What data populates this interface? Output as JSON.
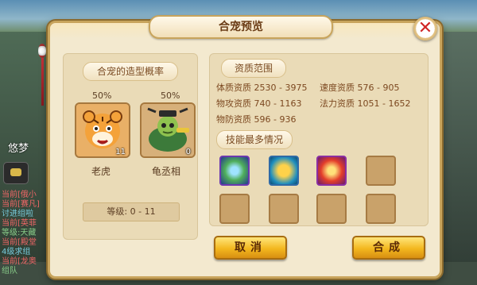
{
  "background": {
    "player_name": "悠梦",
    "chat_lines": [
      {
        "text": "当前[俄小",
        "style": ""
      },
      {
        "text": "当前[赛凡]",
        "style": ""
      },
      {
        "text": "讨进组啦",
        "style": "b"
      },
      {
        "text": "当前[英菲",
        "style": ""
      },
      {
        "text": "等级:天藏",
        "style": "c"
      },
      {
        "text": "当前[殿堂",
        "style": ""
      },
      {
        "text": "4级求组",
        "style": "b"
      },
      {
        "text": "当前[龙奥",
        "style": ""
      },
      {
        "text": "组队",
        "style": "c"
      }
    ]
  },
  "dialog": {
    "title": "合宠预览",
    "close_label": "✕",
    "left": {
      "heading": "合宠的造型概率",
      "pets": [
        {
          "name": "老虎",
          "percent": "50%",
          "count": "11",
          "icon": "tiger-icon"
        },
        {
          "name": "龟丞相",
          "percent": "50%",
          "count": "0",
          "icon": "turtle-minister-icon"
        }
      ],
      "level_text": "等级: 0 - 11"
    },
    "right": {
      "aptitude_heading": "资质范围",
      "aptitudes": [
        {
          "label": "体质资质",
          "value": "2530 - 3975"
        },
        {
          "label": "速度资质",
          "value": "576 - 905"
        },
        {
          "label": "物攻资质",
          "value": "740 - 1163"
        },
        {
          "label": "法力资质",
          "value": "1051 - 1652"
        },
        {
          "label": "物防资质",
          "value": "596 - 936"
        }
      ],
      "skills_heading": "技能最多情况",
      "skills": [
        {
          "icon": "wind-skill-icon",
          "filled": true
        },
        {
          "icon": "gold-warrior-skill-icon",
          "filled": true
        },
        {
          "icon": "fire-skill-icon",
          "filled": true
        },
        {
          "icon": "empty-skill-slot",
          "filled": false
        },
        {
          "icon": "empty-skill-slot",
          "filled": false
        },
        {
          "icon": "empty-skill-slot",
          "filled": false
        },
        {
          "icon": "empty-skill-slot",
          "filled": false
        },
        {
          "icon": "empty-skill-slot",
          "filled": false
        }
      ]
    },
    "buttons": {
      "cancel_label": "取消",
      "combine_label": "合成"
    }
  }
}
